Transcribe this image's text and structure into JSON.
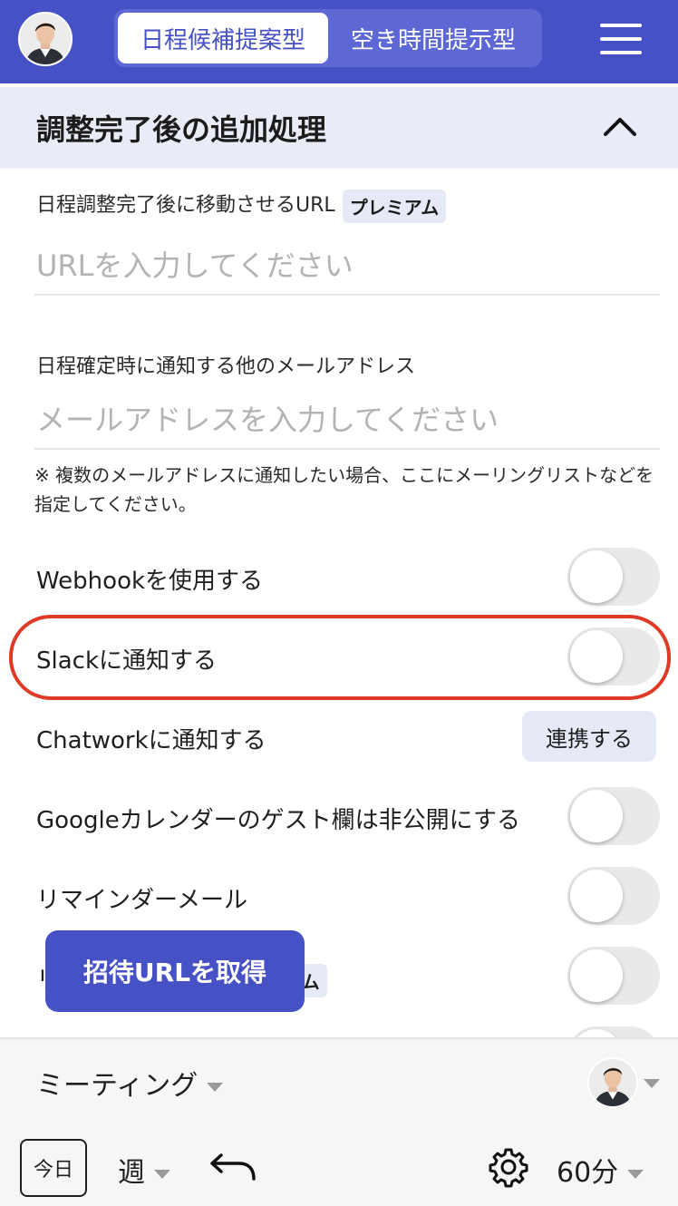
{
  "header": {
    "tabs": [
      {
        "label": "日程候補提案型",
        "active": true
      },
      {
        "label": "空き時間提示型",
        "active": false
      }
    ]
  },
  "section": {
    "title": "調整完了後の追加処理"
  },
  "form": {
    "redirect_url": {
      "label": "日程調整完了後に移動させるURL",
      "badge": "プレミアム",
      "placeholder": "URLを入力してください",
      "value": ""
    },
    "notify_email": {
      "label": "日程確定時に通知する他のメールアドレス",
      "placeholder": "メールアドレスを入力してください",
      "value": "",
      "note": "※ 複数のメールアドレスに通知したい場合、ここにメーリングリストなどを指定してください。"
    }
  },
  "settings": {
    "webhook": {
      "label": "Webhookを使用する",
      "enabled": false
    },
    "slack": {
      "label": "Slackに通知する",
      "enabled": false
    },
    "chatwork": {
      "label": "Chatworkに通知する",
      "button": "連携する"
    },
    "google_guest": {
      "label": "Googleカレンダーのゲスト欄は非公開にする",
      "enabled": false
    },
    "reminder": {
      "label": "リマインダーメール",
      "enabled": false
    },
    "premium_row": {
      "label": "リ",
      "badge": "プレミアム",
      "enabled": false
    }
  },
  "invite_button": "招待URLを取得",
  "bottombar": {
    "meeting_type": "ミーティング",
    "today": "今日",
    "view": "週",
    "duration": "60分"
  },
  "colors": {
    "brand": "#4651c6",
    "highlight": "#e03a26",
    "section_bg": "#e9ebf6"
  }
}
